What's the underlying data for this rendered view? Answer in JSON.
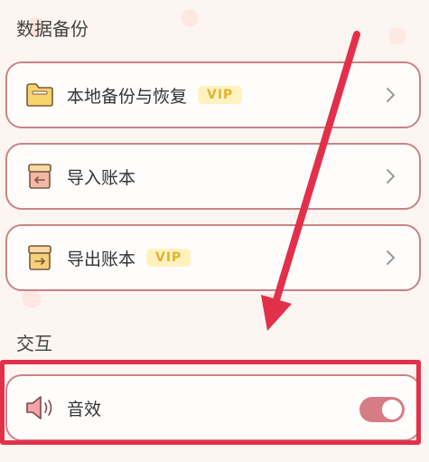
{
  "sections": {
    "backup_title": "数据备份",
    "interaction_title": "交互"
  },
  "items": {
    "local_backup": {
      "label": "本地备份与恢复",
      "badge": "VIP",
      "icon": "folder-icon"
    },
    "import_ledger": {
      "label": "导入账本",
      "icon": "import-box-icon"
    },
    "export_ledger": {
      "label": "导出账本",
      "badge": "VIP",
      "icon": "export-box-icon"
    },
    "sound_effect": {
      "label": "音效",
      "icon": "speaker-icon",
      "toggle_on": true
    }
  },
  "colors": {
    "card_border": "#c98386",
    "toggle_on": "#d77c86",
    "vip_text": "#e0b335",
    "vip_bg": "#fff2bf",
    "annotation": "#e2304b"
  }
}
